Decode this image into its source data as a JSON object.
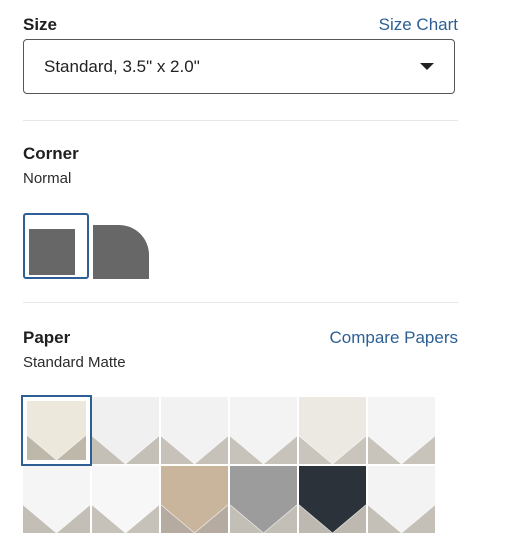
{
  "size": {
    "heading": "Size",
    "chart_link": "Size Chart",
    "selected": "Standard, 3.5\" x 2.0\""
  },
  "corner": {
    "heading": "Corner",
    "selected": "Normal",
    "options": [
      {
        "name": "Normal",
        "selected": true
      },
      {
        "name": "Rounded",
        "selected": false
      }
    ]
  },
  "paper": {
    "heading": "Paper",
    "compare_link": "Compare Papers",
    "selected": "Standard Matte",
    "swatches": [
      {
        "color": "#ece9dc",
        "shadow": "#bdb8a9",
        "selected": true
      },
      {
        "color": "#f0f0f0",
        "shadow": "#c4c0b8"
      },
      {
        "color": "#f2f2f2",
        "shadow": "#c6c2ba"
      },
      {
        "color": "#f3f3f3",
        "shadow": "#c7c3bb"
      },
      {
        "color": "#ece9e2",
        "shadow": "#c9c5bd"
      },
      {
        "color": "#f4f4f4",
        "shadow": "#c8c4bc"
      },
      {
        "color": "#f5f5f5",
        "shadow": "#c3bfb7"
      },
      {
        "color": "#f7f7f7",
        "shadow": "#c6c2ba"
      },
      {
        "color": "#c9b59c",
        "shadow": "#b5aba0"
      },
      {
        "color": "#9c9c9c",
        "shadow": "#c3bfb7"
      },
      {
        "color": "#2c323a",
        "shadow": "#bdb9b1"
      },
      {
        "color": "#f3f3f3",
        "shadow": "#c4c0b8"
      }
    ]
  }
}
